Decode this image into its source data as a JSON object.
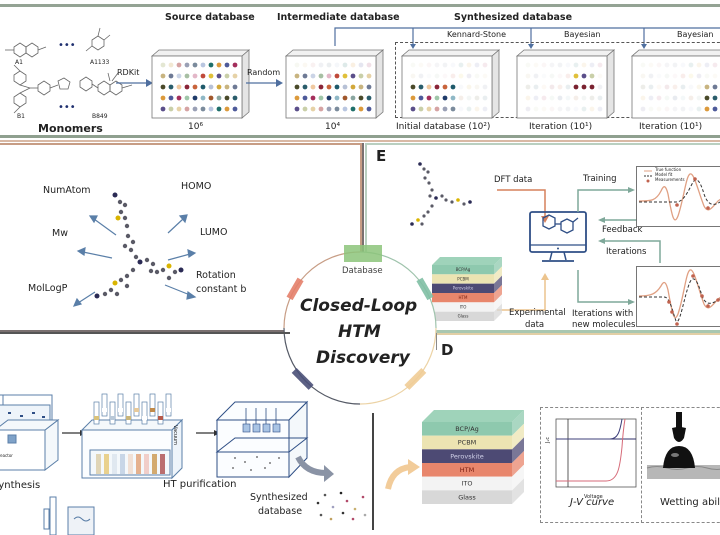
{
  "title": "Closed-Loop HTM Discovery",
  "center": {
    "line1": "Closed-Loop",
    "line2": "HTM",
    "line3": "Discovery",
    "database_tab": "Database",
    "segment_colors": {
      "database": "#8cc47a",
      "left": "#e4806a",
      "right_upper": "#7fbfa4",
      "bottom_left": "#4a5078",
      "bottom_right": "#f0cc96"
    }
  },
  "panel_top": {
    "monomers": {
      "label": "Monomers",
      "items": [
        "A1",
        "A1133",
        "B1",
        "B849"
      ],
      "ellipsis": "•••"
    },
    "arrows": {
      "rdkit": "RDKit",
      "random": "Random"
    },
    "source_db": {
      "title": "Source database",
      "size": "10⁶"
    },
    "intermediate_db": {
      "title": "Intermediate database",
      "size": "10⁴"
    },
    "synthesized_db": {
      "title": "Synthesized database",
      "methods": [
        "Kennard-Stone",
        "Bayesian",
        "Bayesian"
      ],
      "stages": [
        "Initial database (10²)",
        "Iteration (10¹)",
        "Iteration (10¹)"
      ]
    },
    "border_color": "#7a9a7a"
  },
  "panel_descriptors": {
    "labels": [
      "NumAtom",
      "HOMO",
      "Mw",
      "LUMO",
      "MolLogP",
      "Rotation",
      "constant b"
    ],
    "border_color": "#c79d85"
  },
  "panel_E": {
    "letter": "E",
    "dft": "DFT data",
    "training": "Training",
    "feedback": "Feedback",
    "iterations": "Iterations",
    "experimental_line1": "Experimental",
    "experimental_line2": "data",
    "iter_new_line1": "Iterations with",
    "iter_new_line2": "new molecules",
    "legend": [
      "True function",
      "Model fit",
      "Measurements"
    ],
    "stack_layers": [
      "BCP/Ag",
      "PCBM",
      "Perovskite",
      "HTM",
      "ITO",
      "Glass"
    ],
    "border_color": "#8fb59d"
  },
  "panel_synthesis": {
    "synthesis": "Synthesis",
    "reactor": "Microwave reactor",
    "purification": "HT purification",
    "vacuum": "Vacuum",
    "synthesized_line1": "Synthesized",
    "synthesized_line2": "database"
  },
  "panel_D": {
    "letter": "D",
    "stack_layers": [
      "BCP/Ag",
      "PCBM",
      "Perovskite",
      "HTM",
      "ITO",
      "Glass"
    ],
    "jv_label": "J-V curve",
    "jv_xlabel": "Voltage",
    "jv_ylabel": "Jₛc",
    "wetting": "Wetting ability",
    "border_color": "#e2cfa5"
  }
}
